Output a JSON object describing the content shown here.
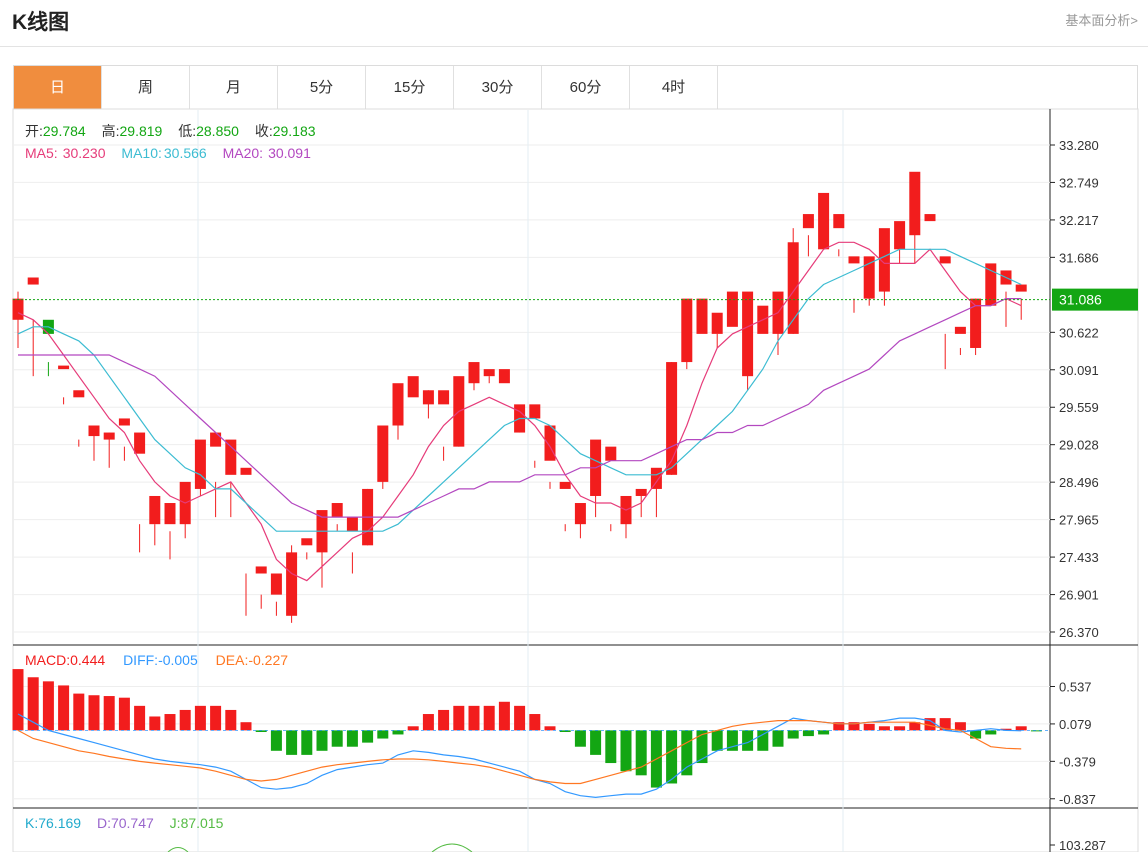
{
  "header": {
    "title": "K线图",
    "analysis_link": "基本面分析>"
  },
  "tabs": [
    {
      "label": "日",
      "active": true
    },
    {
      "label": "周",
      "active": false
    },
    {
      "label": "月",
      "active": false
    },
    {
      "label": "5分",
      "active": false
    },
    {
      "label": "15分",
      "active": false
    },
    {
      "label": "30分",
      "active": false
    },
    {
      "label": "60分",
      "active": false
    },
    {
      "label": "4时",
      "active": false
    }
  ],
  "colors": {
    "up": "#f21d1d",
    "down": "#13a613",
    "ma5": "#e63c7a",
    "ma10": "#3cbcd2",
    "ma20": "#b348c0",
    "diff": "#3399ff",
    "dea": "#ff7722",
    "k": "#22aacc",
    "d": "#9966cc",
    "j": "#55bb44"
  },
  "info": {
    "open_label": "开:",
    "open": "29.784",
    "high_label": "高:",
    "high": "29.819",
    "low_label": "低:",
    "low": "28.850",
    "close_label": "收:",
    "close": "29.183",
    "ma5_label": "MA5:",
    "ma5": "30.230",
    "ma10_label": "MA10:",
    "ma10": "30.566",
    "ma20_label": "MA20:",
    "ma20": "30.091"
  },
  "macd_info": {
    "macd_label": "MACD:",
    "macd": "0.444",
    "diff_label": "DIFF:",
    "diff": "-0.005",
    "dea_label": "DEA:",
    "dea": "-0.227"
  },
  "kdj_info": {
    "k_label": "K:",
    "k": "76.169",
    "d_label": "D:",
    "d": "70.747",
    "j_label": "J:",
    "j": "87.015"
  },
  "chart_data": [
    {
      "type": "candlestick",
      "title": "",
      "ylim": [
        26.37,
        33.28
      ],
      "yticks": [
        "33.280",
        "32.749",
        "32.217",
        "31.686",
        "30.622",
        "30.091",
        "29.559",
        "29.028",
        "28.496",
        "27.965",
        "27.433",
        "26.901",
        "26.370"
      ],
      "current_price": "31.086",
      "ohlc": [
        [
          30.8,
          31.1,
          30.4,
          31.2
        ],
        [
          31.3,
          31.4,
          30.0,
          30.8
        ],
        [
          30.8,
          30.6,
          30.2,
          30.0
        ],
        [
          30.1,
          30.15,
          29.7,
          29.6
        ],
        [
          29.7,
          29.8,
          29.0,
          29.1
        ],
        [
          29.15,
          29.3,
          28.8,
          29.2
        ],
        [
          29.1,
          29.2,
          28.7,
          29.2
        ],
        [
          29.3,
          29.4,
          28.8,
          29.0
        ],
        [
          28.9,
          29.2,
          27.5,
          27.9
        ],
        [
          27.9,
          28.3,
          27.6,
          27.9
        ],
        [
          27.9,
          28.2,
          27.4,
          27.8
        ],
        [
          27.9,
          28.5,
          27.7,
          28.4
        ],
        [
          28.4,
          29.1,
          28.3,
          29.0
        ],
        [
          29.0,
          29.2,
          28.0,
          28.5
        ],
        [
          28.6,
          29.1,
          28.0,
          28.5
        ],
        [
          28.6,
          28.7,
          26.6,
          27.2
        ],
        [
          27.2,
          27.3,
          26.7,
          26.9
        ],
        [
          26.9,
          27.2,
          26.8,
          26.6
        ],
        [
          26.6,
          27.5,
          26.5,
          27.6
        ],
        [
          27.6,
          27.7,
          27.4,
          27.5
        ],
        [
          27.5,
          28.1,
          27.0,
          28.0
        ],
        [
          28.0,
          28.2,
          27.8,
          27.9
        ],
        [
          27.8,
          28.0,
          27.2,
          27.5
        ],
        [
          27.6,
          28.4,
          27.6,
          28.4
        ],
        [
          28.5,
          29.3,
          28.4,
          29.3
        ],
        [
          29.3,
          29.9,
          29.1,
          29.7
        ],
        [
          29.7,
          30.0,
          29.6,
          29.6
        ],
        [
          29.6,
          29.8,
          29.4,
          29.8
        ],
        [
          29.6,
          29.8,
          28.8,
          29.0
        ],
        [
          29.0,
          30.0,
          29.0,
          29.9
        ],
        [
          29.9,
          30.2,
          29.8,
          30.0
        ],
        [
          30.0,
          30.1,
          29.9,
          30.0
        ],
        [
          29.9,
          30.1,
          29.2,
          29.2
        ],
        [
          29.2,
          29.6,
          29.2,
          29.4
        ],
        [
          29.4,
          29.6,
          28.7,
          28.8
        ],
        [
          28.8,
          29.3,
          28.4,
          28.5
        ],
        [
          28.4,
          28.5,
          27.8,
          27.9
        ],
        [
          27.9,
          28.2,
          27.7,
          28.0
        ],
        [
          28.3,
          29.1,
          28.0,
          28.8
        ],
        [
          28.8,
          29.0,
          27.8,
          27.9
        ],
        [
          27.9,
          28.3,
          27.7,
          28.3
        ],
        [
          28.3,
          28.4,
          28.0,
          28.3
        ],
        [
          28.4,
          28.7,
          28.0,
          28.6
        ],
        [
          28.6,
          30.2,
          28.6,
          30.2
        ],
        [
          30.2,
          31.1,
          30.1,
          31.0
        ],
        [
          30.6,
          31.1,
          30.6,
          30.6
        ],
        [
          30.6,
          30.9,
          30.4,
          30.6
        ],
        [
          30.7,
          31.2,
          30.0,
          30.0
        ],
        [
          30.0,
          31.2,
          29.8,
          30.6
        ],
        [
          30.6,
          31.0,
          30.6,
          30.6
        ],
        [
          30.6,
          31.2,
          30.3,
          30.9
        ],
        [
          30.6,
          31.9,
          30.6,
          32.1
        ],
        [
          32.1,
          32.3,
          31.7,
          32.0
        ],
        [
          31.8,
          32.6,
          31.8,
          32.1
        ],
        [
          32.1,
          32.3,
          31.7,
          31.8
        ],
        [
          31.6,
          31.7,
          30.9,
          31.1
        ],
        [
          31.1,
          31.7,
          31.0,
          31.2
        ],
        [
          31.2,
          32.1,
          31.0,
          31.7
        ],
        [
          31.8,
          32.2,
          31.6,
          32.0
        ],
        [
          32.0,
          32.9,
          31.6,
          32.1
        ],
        [
          32.2,
          32.3,
          31.6,
          31.6
        ],
        [
          31.6,
          31.7,
          30.1,
          30.6
        ],
        [
          30.6,
          30.7,
          30.3,
          30.4
        ],
        [
          30.4,
          31.1,
          30.3,
          31.1
        ],
        [
          31.0,
          31.6,
          31.0,
          31.4
        ],
        [
          31.3,
          31.5,
          30.7,
          31.2
        ],
        [
          31.2,
          31.3,
          30.8,
          31.1
        ]
      ],
      "ma5": [
        30.9,
        30.8,
        30.6,
        30.3,
        30.0,
        29.7,
        29.4,
        29.2,
        28.8,
        28.5,
        28.3,
        28.2,
        28.3,
        28.4,
        28.5,
        28.2,
        27.9,
        27.4,
        27.2,
        27.1,
        27.3,
        27.5,
        27.7,
        27.8,
        28.0,
        28.3,
        28.6,
        29.0,
        29.3,
        29.5,
        29.6,
        29.7,
        29.6,
        29.5,
        29.3,
        29.0,
        28.6,
        28.3,
        28.2,
        28.2,
        28.1,
        28.2,
        28.5,
        28.8,
        29.3,
        29.9,
        30.4,
        30.6,
        30.7,
        30.8,
        30.9,
        31.2,
        31.5,
        31.8,
        31.9,
        31.9,
        31.8,
        31.6,
        31.6,
        31.6,
        31.8,
        31.5,
        31.2,
        31.0,
        31.0,
        31.1,
        31.0
      ],
      "ma10": [
        30.6,
        30.7,
        30.7,
        30.6,
        30.5,
        30.3,
        30.0,
        29.7,
        29.4,
        29.1,
        28.9,
        28.7,
        28.6,
        28.4,
        28.4,
        28.2,
        28.0,
        27.8,
        27.8,
        27.8,
        27.8,
        27.8,
        27.8,
        27.8,
        27.8,
        27.9,
        28.1,
        28.3,
        28.5,
        28.7,
        28.9,
        29.1,
        29.3,
        29.4,
        29.4,
        29.3,
        29.1,
        28.9,
        28.8,
        28.7,
        28.6,
        28.6,
        28.6,
        28.7,
        28.9,
        29.1,
        29.3,
        29.5,
        29.8,
        30.1,
        30.5,
        30.8,
        31.1,
        31.3,
        31.4,
        31.5,
        31.6,
        31.7,
        31.8,
        31.8,
        31.8,
        31.8,
        31.7,
        31.6,
        31.5,
        31.4,
        31.3
      ],
      "ma20": [
        30.3,
        30.3,
        30.3,
        30.3,
        30.3,
        30.3,
        30.3,
        30.2,
        30.1,
        30.0,
        29.8,
        29.6,
        29.4,
        29.2,
        29.0,
        28.8,
        28.6,
        28.4,
        28.2,
        28.1,
        28.0,
        28.0,
        28.0,
        28.0,
        28.0,
        28.0,
        28.1,
        28.2,
        28.3,
        28.4,
        28.4,
        28.5,
        28.5,
        28.5,
        28.6,
        28.6,
        28.6,
        28.7,
        28.7,
        28.8,
        28.8,
        28.8,
        28.9,
        29.0,
        29.1,
        29.1,
        29.2,
        29.2,
        29.3,
        29.3,
        29.4,
        29.5,
        29.6,
        29.8,
        29.9,
        30.0,
        30.1,
        30.3,
        30.5,
        30.6,
        30.7,
        30.8,
        30.9,
        31.0,
        31.0,
        31.1,
        31.1
      ]
    },
    {
      "type": "bar",
      "title": "",
      "ylim": [
        -0.95,
        0.8
      ],
      "yticks": [
        "0.537",
        "0.079",
        "-0.379",
        "-0.837"
      ],
      "macd": [
        0.75,
        0.65,
        0.6,
        0.55,
        0.45,
        0.43,
        0.42,
        0.4,
        0.3,
        0.17,
        0.2,
        0.25,
        0.3,
        0.3,
        0.25,
        0.1,
        -0.02,
        -0.25,
        -0.3,
        -0.3,
        -0.25,
        -0.2,
        -0.2,
        -0.15,
        -0.1,
        -0.05,
        0.05,
        0.2,
        0.25,
        0.3,
        0.3,
        0.3,
        0.35,
        0.3,
        0.2,
        0.05,
        -0.02,
        -0.2,
        -0.3,
        -0.4,
        -0.5,
        -0.55,
        -0.7,
        -0.65,
        -0.55,
        -0.4,
        -0.25,
        -0.25,
        -0.25,
        -0.25,
        -0.2,
        -0.1,
        -0.07,
        -0.05,
        0.1,
        0.1,
        0.08,
        0.05,
        0.05,
        0.1,
        0.15,
        0.15,
        0.1,
        -0.1,
        -0.05,
        0.02,
        0.05,
        -0.01
      ],
      "diff": [
        0.2,
        0.1,
        0.0,
        -0.05,
        -0.1,
        -0.15,
        -0.2,
        -0.25,
        -0.3,
        -0.35,
        -0.38,
        -0.4,
        -0.42,
        -0.45,
        -0.5,
        -0.6,
        -0.7,
        -0.72,
        -0.7,
        -0.65,
        -0.55,
        -0.48,
        -0.45,
        -0.42,
        -0.4,
        -0.3,
        -0.25,
        -0.27,
        -0.3,
        -0.32,
        -0.35,
        -0.4,
        -0.45,
        -0.5,
        -0.6,
        -0.65,
        -0.75,
        -0.8,
        -0.82,
        -0.8,
        -0.78,
        -0.78,
        -0.72,
        -0.6,
        -0.45,
        -0.35,
        -0.25,
        -0.2,
        -0.15,
        -0.05,
        0.05,
        0.15,
        0.12,
        0.1,
        0.08,
        0.08,
        0.1,
        0.12,
        0.15,
        0.15,
        0.12,
        0.0,
        -0.02,
        0.0,
        0.02,
        0.0,
        -0.005
      ],
      "dea": [
        0.0,
        -0.1,
        -0.15,
        -0.2,
        -0.25,
        -0.28,
        -0.32,
        -0.35,
        -0.38,
        -0.4,
        -0.42,
        -0.44,
        -0.46,
        -0.5,
        -0.55,
        -0.6,
        -0.62,
        -0.6,
        -0.55,
        -0.5,
        -0.45,
        -0.42,
        -0.4,
        -0.38,
        -0.36,
        -0.35,
        -0.35,
        -0.36,
        -0.38,
        -0.4,
        -0.42,
        -0.45,
        -0.5,
        -0.55,
        -0.6,
        -0.63,
        -0.65,
        -0.65,
        -0.6,
        -0.55,
        -0.5,
        -0.45,
        -0.35,
        -0.25,
        -0.15,
        -0.05,
        0.0,
        0.05,
        0.08,
        0.1,
        0.12,
        0.12,
        0.12,
        0.1,
        0.08,
        0.08,
        0.1,
        0.1,
        0.1,
        0.1,
        0.06,
        0.02,
        0.0,
        -0.1,
        -0.2,
        -0.22,
        -0.227
      ]
    },
    {
      "type": "line",
      "title": "",
      "yticks": [
        "103.287"
      ]
    }
  ]
}
